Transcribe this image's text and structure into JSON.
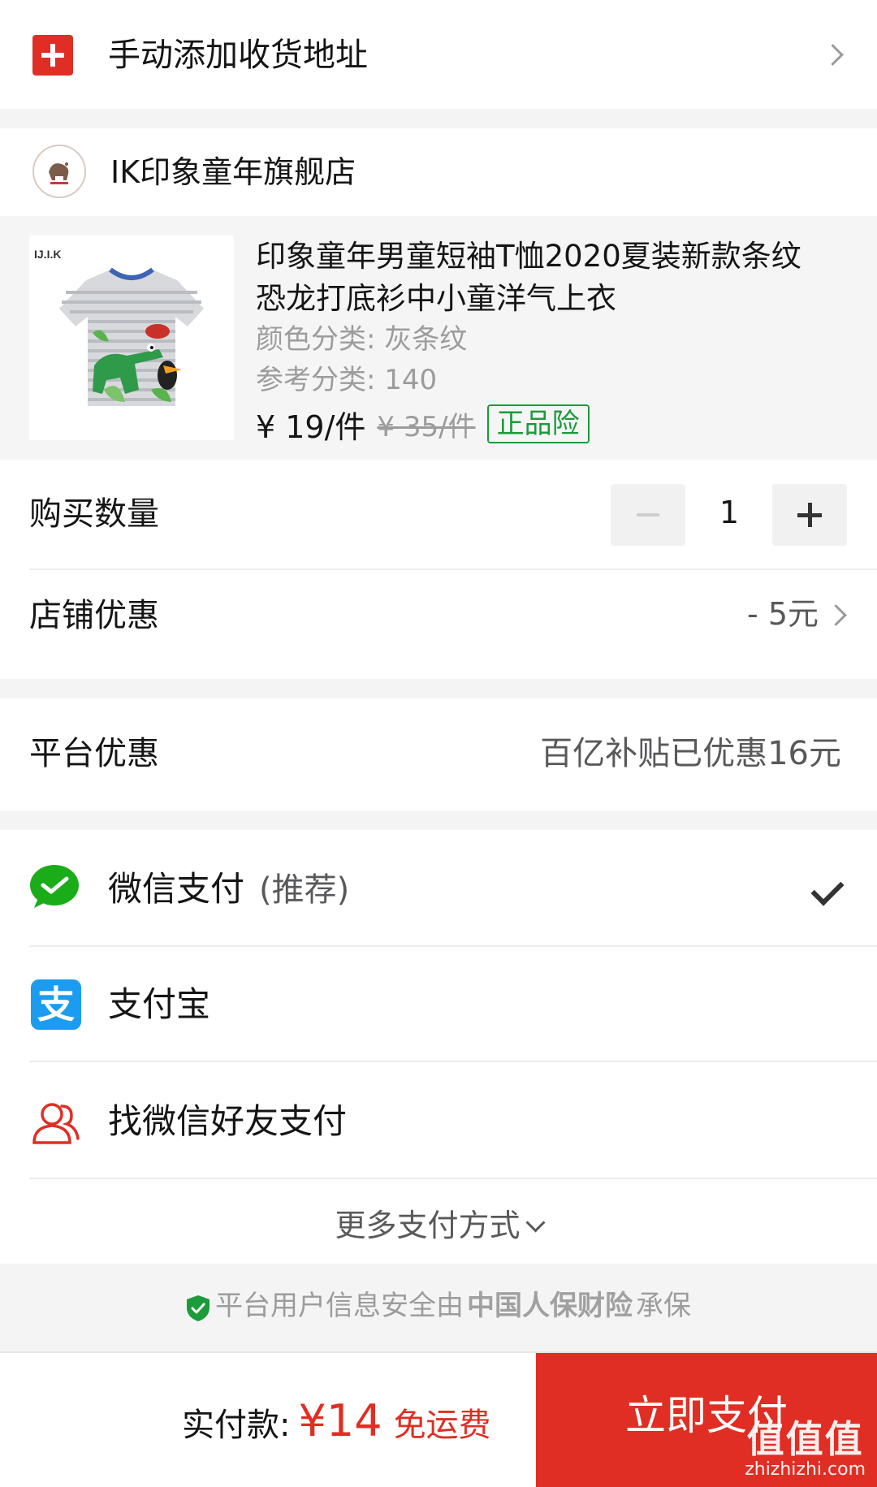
{
  "address": {
    "label": "手动添加收货地址"
  },
  "store": {
    "name": "IK印象童年旗舰店",
    "logo_text": "IJ.I.K"
  },
  "product": {
    "title_line1": "印象童年男童短袖T恤2020夏装新款条纹",
    "title_line2": "恐龙打底衫中小童洋气上衣",
    "color_spec": "颜色分类: 灰条纹",
    "size_spec": "参考分类: 140",
    "price": "¥ 19/件",
    "original_price": "¥ 35/件",
    "badge": "正品险",
    "image_logo": "IJ.I.K"
  },
  "quantity": {
    "label": "购买数量",
    "value": "1"
  },
  "shop_discount": {
    "label": "店铺优惠",
    "value": "- 5元"
  },
  "platform_discount": {
    "label": "平台优惠",
    "value": "百亿补贴已优惠16元"
  },
  "payment": {
    "wechat_label": "微信支付",
    "wechat_note": "(推荐)",
    "alipay_label": "支付宝",
    "alipay_glyph": "支",
    "friend_label": "找微信好友支付",
    "more_label": "更多支付方式"
  },
  "security": {
    "prefix": "平台用户信息安全由",
    "brand": "中国人保财险",
    "suffix": "承保"
  },
  "bottom": {
    "total_label": "实付款:",
    "total_price": "¥14",
    "free_shipping": "免运费",
    "pay_button": "立即支付"
  },
  "watermark": {
    "main": "值值值",
    "sub": "zhizhizhi.com"
  },
  "colors": {
    "brand_red": "#e02e24",
    "wechat_green": "#1aad19",
    "alipay_blue": "#1b9cf0",
    "badge_green": "#1b9b3a"
  }
}
